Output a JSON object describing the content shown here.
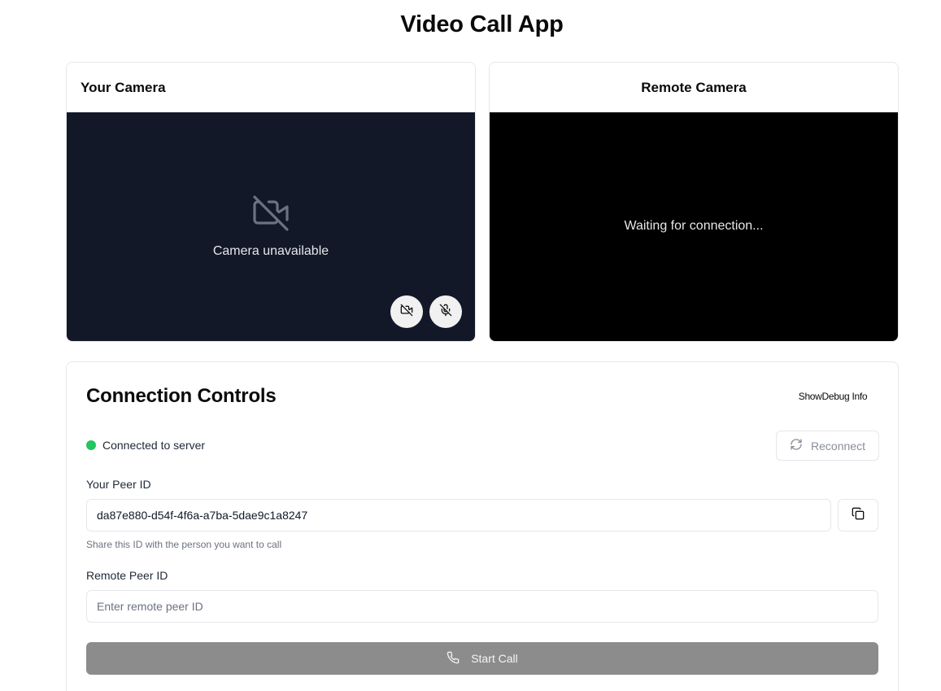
{
  "app": {
    "title": "Video Call App"
  },
  "local": {
    "title": "Your Camera",
    "status_text": "Camera unavailable",
    "icons": {
      "status": "camera-off-icon",
      "toggle_camera": "camera-off-icon",
      "toggle_mic": "mic-off-icon"
    }
  },
  "remote": {
    "title": "Remote Camera",
    "status_text": "Waiting for connection..."
  },
  "controls": {
    "title": "Connection Controls",
    "debug_label": "ShowDebug Info",
    "status": {
      "text": "Connected to server",
      "color": "#22c55e"
    },
    "reconnect_label": "Reconnect",
    "peer_id_label": "Your Peer ID",
    "peer_id_value": "da87e880-d54f-4f6a-a7ba-5dae9c1a8247",
    "peer_hint": "Share this ID with the person you want to call",
    "remote_label": "Remote Peer ID",
    "remote_placeholder": "Enter remote peer ID",
    "start_label": "Start Call",
    "start_color": "#8c8c8c"
  }
}
